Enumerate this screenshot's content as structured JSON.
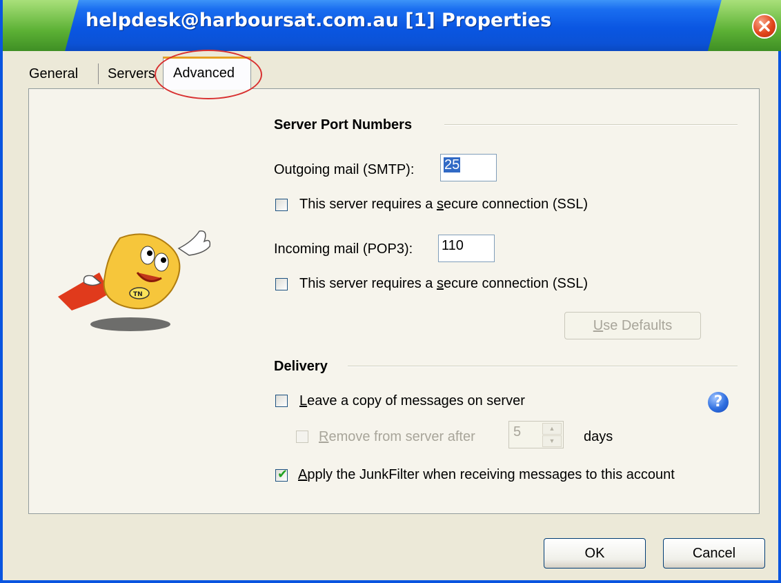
{
  "window": {
    "title": "helpdesk@harboursat.com.au [1] Properties"
  },
  "tabs": [
    {
      "label": "General",
      "active": false
    },
    {
      "label": "Servers",
      "active": false
    },
    {
      "label": "Advanced",
      "active": true
    }
  ],
  "server_ports": {
    "section_title": "Server Port Numbers",
    "outgoing_label": "Outgoing mail (SMTP):",
    "outgoing_value": "25",
    "outgoing_ssl_label_pre": "This server requires a ",
    "outgoing_ssl_label_accel": "s",
    "outgoing_ssl_label_post": "ecure connection (SSL)",
    "outgoing_ssl_checked": false,
    "incoming_label": "Incoming mail (POP3):",
    "incoming_value": "110",
    "incoming_ssl_label_pre": "This server requires a ",
    "incoming_ssl_label_accel": "s",
    "incoming_ssl_label_post": "ecure connection (SSL)",
    "incoming_ssl_checked": false,
    "use_defaults_accel": "U",
    "use_defaults_rest": "se Defaults"
  },
  "delivery": {
    "section_title": "Delivery",
    "leave_copy_accel": "L",
    "leave_copy_rest": "eave a copy of messages on server",
    "leave_copy_checked": false,
    "remove_after_accel": "R",
    "remove_after_rest": "emove from server after",
    "remove_after_days": "5",
    "days_label": "days",
    "junkfilter_accel": "A",
    "junkfilter_rest": "pply the JunkFilter when receiving messages to this account",
    "junkfilter_checked": true
  },
  "buttons": {
    "ok": "OK",
    "cancel": "Cancel"
  },
  "icons": {
    "close": "close-icon",
    "help": "help-icon",
    "mascot": "mascot-image"
  },
  "colors": {
    "title_bar": "#0a56e2",
    "dialog_bg": "#ece9d8",
    "tab_highlight": "#e6a021",
    "annotation_circle": "#d83030"
  }
}
